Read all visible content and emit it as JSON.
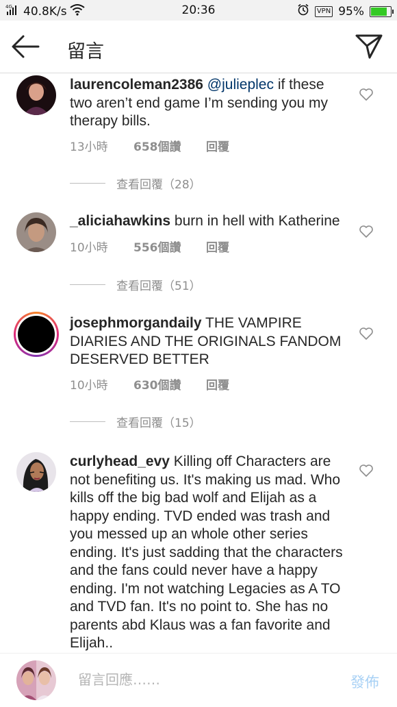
{
  "status": {
    "signal": "4G",
    "speed": "40.8K/s",
    "time": "20:36",
    "vpn": "VPN",
    "battery": "95%",
    "battery_level": 0.95
  },
  "header": {
    "title": "留言"
  },
  "comments": [
    {
      "username": "laurencoleman2386",
      "mention": "@julieplec",
      "text": " if these two aren’t end game I’m sending you my therapy bills.",
      "time": "13小時",
      "likes": "658個讚",
      "reply": "回覆",
      "view_replies": "查看回覆（28）"
    },
    {
      "username": "_aliciahawkins",
      "mention": "",
      "text": " burn in hell with Katherine",
      "time": "10小時",
      "likes": "556個讚",
      "reply": "回覆",
      "view_replies": "查看回覆（51）"
    },
    {
      "username": "josephmorgandaily",
      "mention": "",
      "text": " THE VAMPIRE DIARIES AND THE ORIGINALS FANDOM DESERVED BETTER",
      "time": "10小時",
      "likes": "630個讚",
      "reply": "回覆",
      "view_replies": "查看回覆（15）"
    },
    {
      "username": "curlyhead_evy",
      "mention": "",
      "text": " Killing off Characters are not benefiting us. It's making us mad. Who kills off the big bad wolf and Elijah as a happy ending. TVD ended was trash and you messed up an whole other series ending. It's just sadding that the characters and the fans could never have a happy ending. I'm not watching Legacies as A TO and TVD fan. It's no point to. She has no parents abd Klaus was a fan favorite and Elijah..",
      "time": "",
      "likes": "",
      "reply": "",
      "view_replies": ""
    }
  ],
  "composer": {
    "placeholder": "留言回應……",
    "post_label": "發佈"
  },
  "icons": {
    "back": "back-arrow-icon",
    "send": "paper-plane-icon",
    "like": "heart-icon"
  },
  "colors": {
    "mention": "#003569",
    "meta": "#8e8e8e",
    "post_disabled": "#a8d1f5",
    "battery": "#34c924"
  }
}
